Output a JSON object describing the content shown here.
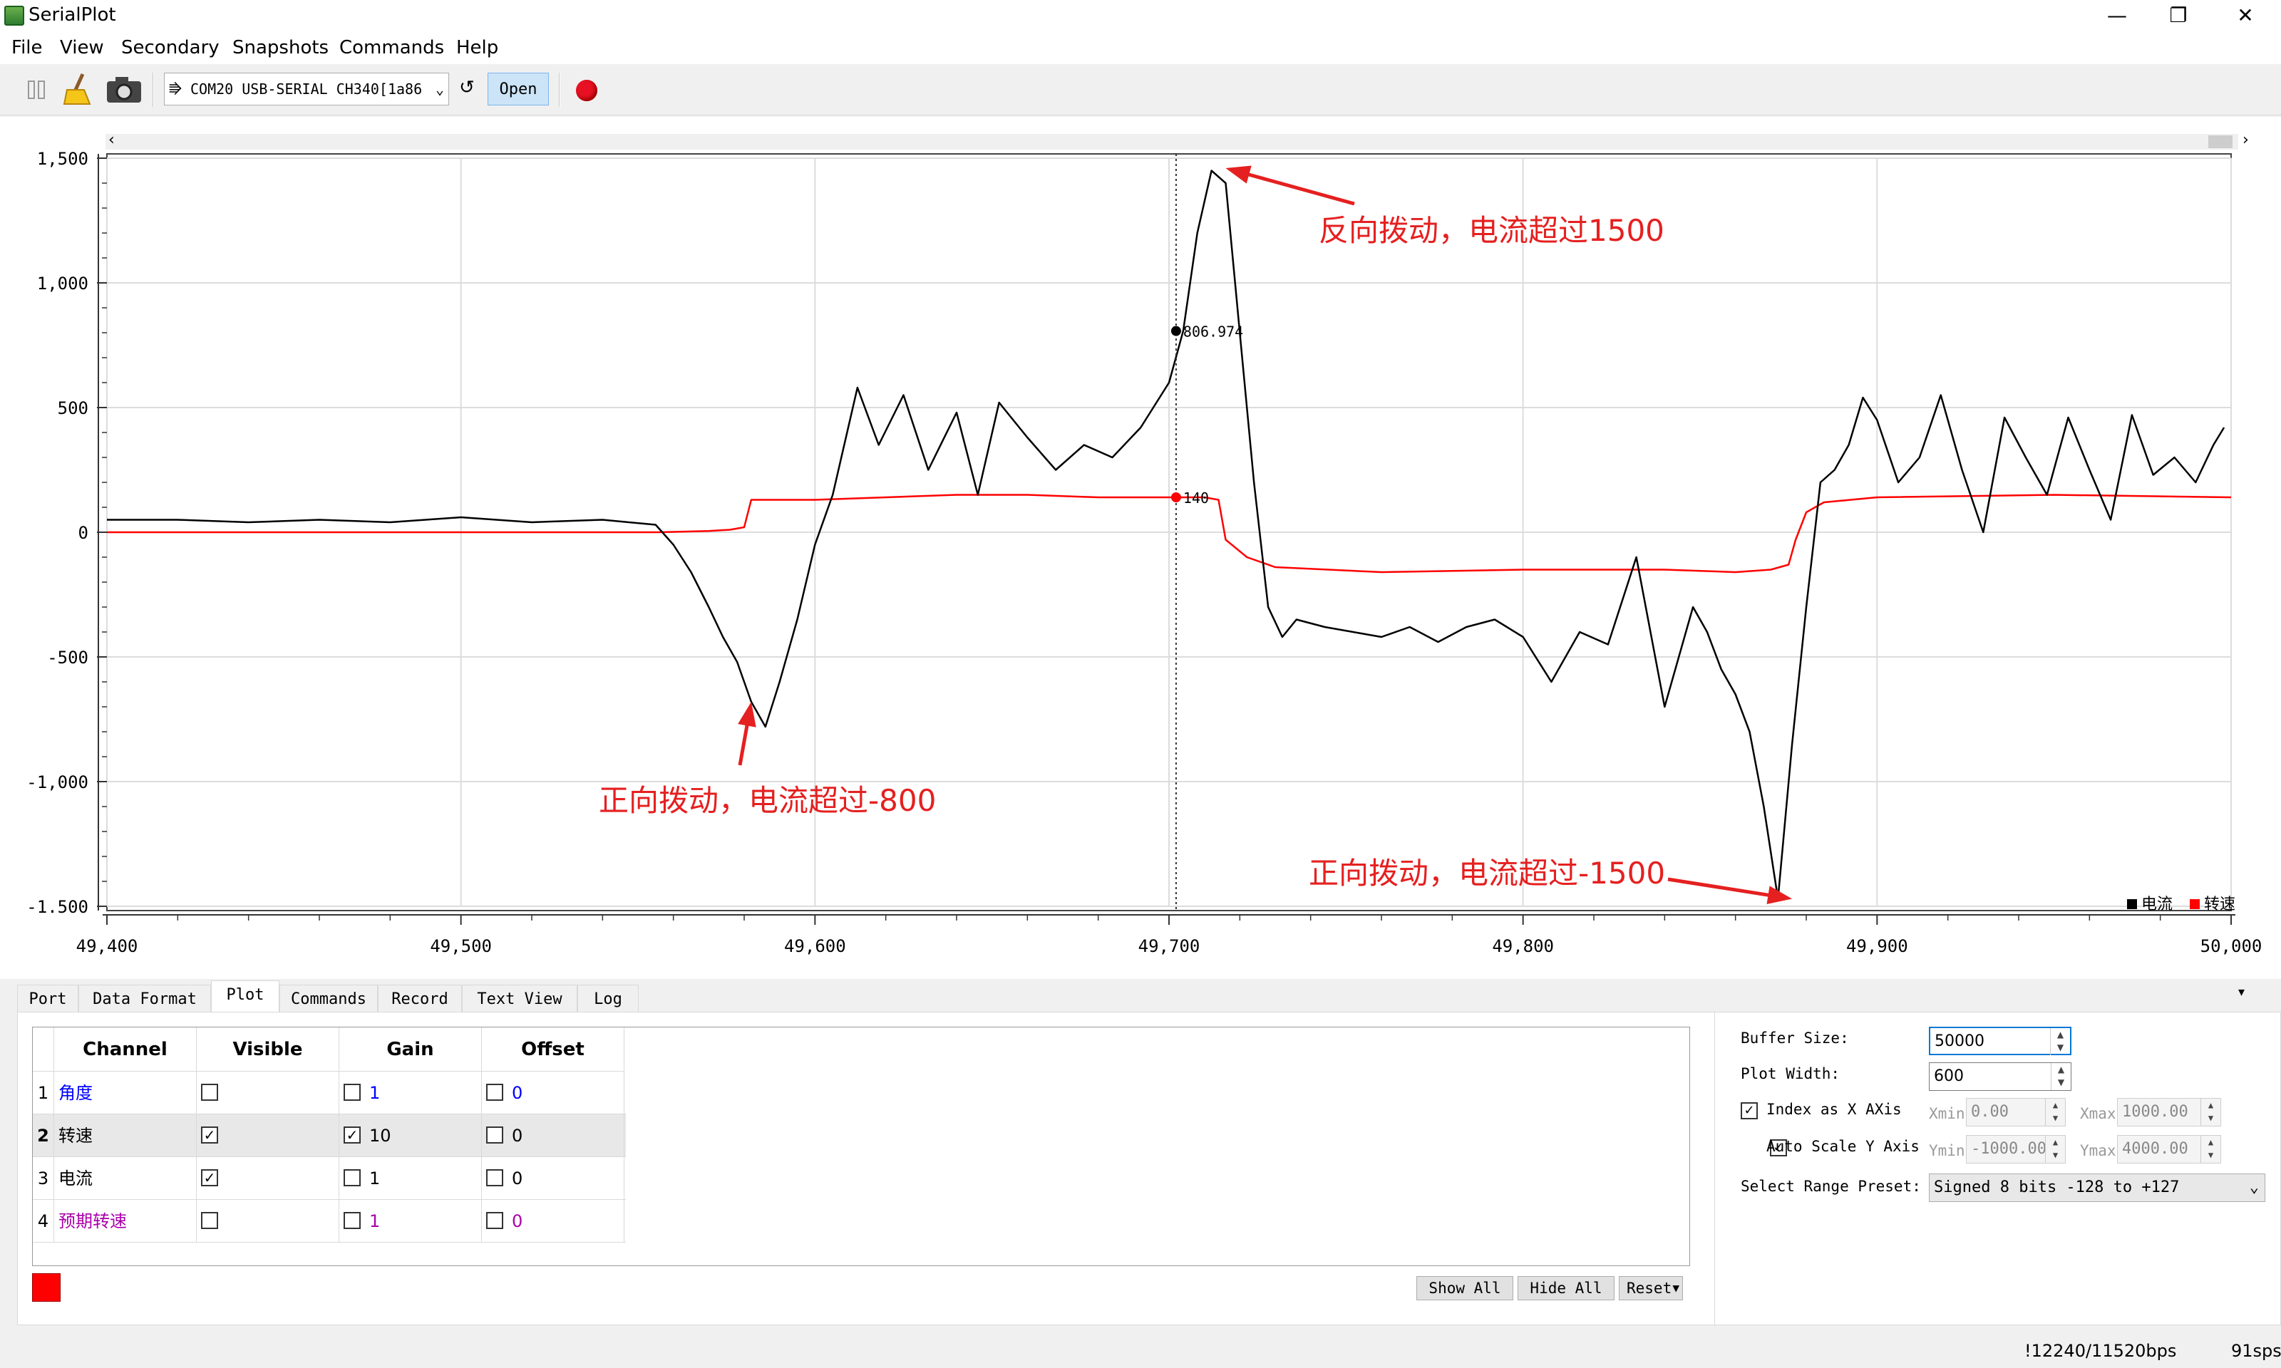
{
  "window": {
    "title": "SerialPlot",
    "controls": [
      "—",
      "❐",
      "✕"
    ]
  },
  "menu": [
    "File",
    "View",
    "Secondary",
    "Snapshots",
    "Commands",
    "Help"
  ],
  "toolbar": {
    "port": "COM20 USB-SERIAL CH340[1a86",
    "open_label": "Open",
    "refresh_glyph": "↺"
  },
  "chart_data": {
    "type": "line",
    "xlim": [
      49400,
      50000
    ],
    "ylim": [
      -1500,
      1500
    ],
    "x_ticks": [
      "49,400",
      "49,500",
      "49,600",
      "49,700",
      "49,800",
      "49,900",
      "50,000"
    ],
    "y_ticks": [
      "1,500",
      "1,000",
      "500",
      "0",
      "-500",
      "-1,000",
      "-1.500"
    ],
    "grid": true,
    "legend_position": "bottom-right",
    "series": [
      {
        "name": "电流",
        "color": "#000000",
        "x": [
          49400,
          49420,
          49440,
          49460,
          49480,
          49500,
          49520,
          49540,
          49555,
          49560,
          49565,
          49570,
          49574,
          49578,
          49582,
          49586,
          49590,
          49595,
          49600,
          49605,
          49612,
          49618,
          49625,
          49632,
          49640,
          49646,
          49652,
          49660,
          49668,
          49676,
          49684,
          49692,
          49700,
          49704,
          49708,
          49712,
          49716,
          49720,
          49724,
          49728,
          49732,
          49736,
          49744,
          49752,
          49760,
          49768,
          49776,
          49784,
          49792,
          49800,
          49808,
          49816,
          49824,
          49832,
          49840,
          49848,
          49852,
          49856,
          49860,
          49864,
          49868,
          49872,
          49876,
          49880,
          49884,
          49888,
          49892,
          49896,
          49900,
          49906,
          49912,
          49918,
          49924,
          49930,
          49936,
          49942,
          49948,
          49954,
          49960,
          49966,
          49972,
          49978,
          49984,
          49990,
          49995,
          49998
        ],
        "values": [
          50,
          50,
          40,
          50,
          40,
          60,
          40,
          50,
          30,
          -50,
          -160,
          -300,
          -420,
          -520,
          -680,
          -780,
          -600,
          -350,
          -50,
          150,
          580,
          350,
          550,
          250,
          480,
          150,
          520,
          380,
          250,
          350,
          300,
          420,
          600,
          806.974,
          1200,
          1450,
          1400,
          800,
          200,
          -300,
          -420,
          -350,
          -380,
          -400,
          -420,
          -380,
          -440,
          -380,
          -350,
          -420,
          -600,
          -400,
          -450,
          -100,
          -700,
          -300,
          -400,
          -550,
          -650,
          -800,
          -1100,
          -1470,
          -850,
          -300,
          200,
          250,
          350,
          540,
          450,
          200,
          300,
          550,
          250,
          0,
          460,
          300,
          150,
          460,
          250,
          50,
          470,
          230,
          300,
          200,
          350,
          420
        ]
      },
      {
        "name": "转速",
        "color": "#ff0000",
        "x": [
          49400,
          49450,
          49500,
          49530,
          49556,
          49570,
          49576,
          49580,
          49582,
          49600,
          49620,
          49640,
          49660,
          49680,
          49700,
          49710,
          49714,
          49716,
          49722,
          49730,
          49760,
          49800,
          49840,
          49860,
          49870,
          49875,
          49877,
          49880,
          49885,
          49900,
          49950,
          50000
        ],
        "values": [
          0,
          0,
          0,
          0,
          0,
          5,
          10,
          20,
          130,
          130,
          140,
          150,
          150,
          140,
          140,
          140,
          130,
          -30,
          -100,
          -140,
          -160,
          -150,
          -150,
          -160,
          -150,
          -130,
          -30,
          80,
          120,
          140,
          150,
          140
        ]
      }
    ],
    "cursor": {
      "x": 49702,
      "labels": [
        "806.974",
        "140"
      ],
      "values": [
        806.974,
        140
      ]
    },
    "annotations": [
      {
        "text": "反向拨动，电流超过1500",
        "x": 49716,
        "y": 1460
      },
      {
        "text": "正向拨动，电流超过-800",
        "x": 49582,
        "y": -680
      },
      {
        "text": "正向拨动，电流超过-1500",
        "x": 49876,
        "y": -1470
      }
    ]
  },
  "tabs": [
    "Port",
    "Data Format",
    "Plot",
    "Commands",
    "Record",
    "Text View",
    "Log"
  ],
  "channel_table": {
    "headers": [
      "Channel",
      "Visible",
      "Gain",
      "Offset"
    ],
    "rows": [
      {
        "index": "1",
        "name": "角度",
        "visible": "",
        "gain": "1",
        "offset": "0",
        "color": "#0000ff"
      },
      {
        "index": "2",
        "name": "转速",
        "visible": "✓",
        "gain": "10",
        "gain_checked": "✓",
        "offset": "0",
        "color": "#000000"
      },
      {
        "index": "3",
        "name": "电流",
        "visible": "✓",
        "gain": "1",
        "offset": "0",
        "color": "#000000"
      },
      {
        "index": "4",
        "name": "预期转速",
        "visible": "",
        "gain": "1",
        "offset": "0",
        "color": "#aa00aa"
      }
    ],
    "buttons": [
      "Show All",
      "Hide All",
      "Reset"
    ],
    "reset_arrow": "▼"
  },
  "settings": {
    "buffer_size_label": "Buffer Size:",
    "buffer_size": "50000",
    "plot_width_label": "Plot Width:",
    "plot_width": "600",
    "index_as_x_label": "Index as X AXis",
    "xmin_label": "Xmin",
    "xmin": "0.00",
    "xmax_label": "Xmax",
    "xmax": "1000.00",
    "auto_scale_label": "Auto Scale Y Axis",
    "ymin_label": "Ymin",
    "ymin": "-1000.00",
    "ymax_label": "Ymax",
    "ymax": "4000.00",
    "range_preset_label": "Select Range Preset:",
    "range_preset": "Signed 8 bits -128 to +127"
  },
  "status": {
    "bps": "!12240/11520bps",
    "sps": "91sps"
  },
  "colors": {
    "accent": "#cce4f7",
    "record": "#e81123"
  }
}
